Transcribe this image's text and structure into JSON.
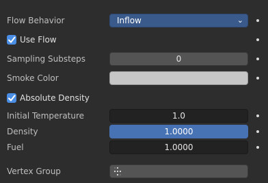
{
  "flow_behavior": {
    "label": "Flow Behavior",
    "value": "Inflow"
  },
  "use_flow": {
    "label": "Use Flow",
    "checked": true
  },
  "sampling_substeps": {
    "label": "Sampling Substeps",
    "value": "0"
  },
  "smoke_color": {
    "label": "Smoke Color",
    "color": "#c6c6c6"
  },
  "absolute_density": {
    "label": "Absolute Density",
    "checked": true
  },
  "initial_temperature": {
    "label": "Initial Temperature",
    "value": "1.0"
  },
  "density": {
    "label": "Density",
    "value": "1.0000"
  },
  "fuel": {
    "label": "Fuel",
    "value": "1.0000"
  },
  "vertex_group": {
    "label": "Vertex Group",
    "value": ""
  },
  "colors": {
    "accent": "#4772b3",
    "dropdown": "#3a5a8c",
    "checkbox": "#4a8ee6"
  }
}
